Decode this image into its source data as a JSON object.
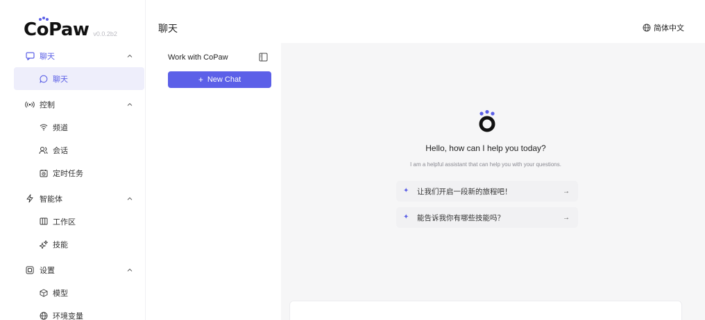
{
  "app": {
    "logo_text_pre": "C",
    "logo_text_o": "o",
    "logo_text_post": "Paw",
    "version": "v0.0.2b2"
  },
  "colors": {
    "accent": "#5c60e8",
    "selected_bg": "#eeeefb",
    "main_bg": "#f6f6f7"
  },
  "header": {
    "title": "聊天",
    "language": "简体中文",
    "language_icon": "globe-icon"
  },
  "sidebar": {
    "groups": [
      {
        "label": "聊天",
        "icon": "chat-bubble-icon",
        "expanded": true,
        "items": [
          {
            "label": "聊天",
            "icon": "message-circle-icon",
            "selected": true
          }
        ]
      },
      {
        "label": "控制",
        "icon": "broadcast-icon",
        "expanded": true,
        "items": [
          {
            "label": "频道",
            "icon": "wifi-icon",
            "selected": false
          },
          {
            "label": "会话",
            "icon": "users-icon",
            "selected": false
          },
          {
            "label": "定时任务",
            "icon": "calendar-clock-icon",
            "selected": false
          }
        ]
      },
      {
        "label": "智能体",
        "icon": "lightning-icon",
        "expanded": true,
        "items": [
          {
            "label": "工作区",
            "icon": "columns-icon",
            "selected": false
          },
          {
            "label": "技能",
            "icon": "sparkles-icon",
            "selected": false
          }
        ]
      },
      {
        "label": "设置",
        "icon": "settings-box-icon",
        "expanded": true,
        "items": [
          {
            "label": "模型",
            "icon": "cube-icon",
            "selected": false
          },
          {
            "label": "环境变量",
            "icon": "globe-icon",
            "selected": false
          }
        ]
      }
    ]
  },
  "chatlist": {
    "title": "Work with CoPaw",
    "toggle_icon": "panel-toggle-icon",
    "new_chat_label": "New Chat",
    "new_chat_icon": "plus-icon"
  },
  "main": {
    "welcome_title": "Hello, how can I help you today?",
    "welcome_subtitle": "I am a helpful assistant that can help you with your questions.",
    "suggestions": [
      {
        "text": "让我们开启一段新的旅程吧！",
        "icon": "sparkle-icon",
        "arrow": "→"
      },
      {
        "text": "能告诉我你有哪些技能吗？",
        "icon": "sparkle-icon",
        "arrow": "→"
      }
    ]
  }
}
